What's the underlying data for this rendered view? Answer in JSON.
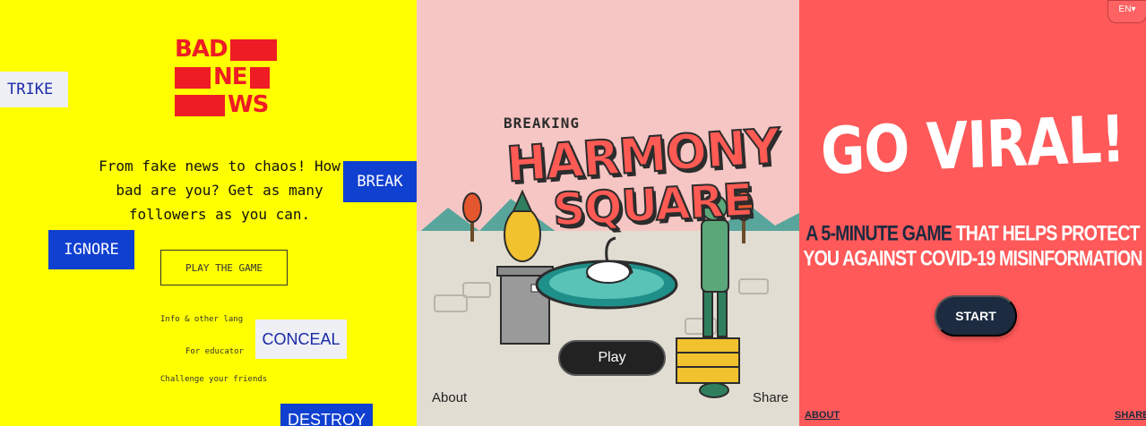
{
  "bad_news": {
    "logo": [
      "BAD",
      "NE",
      "WS"
    ],
    "tagline": [
      "From fake news to chaos! How",
      "bad are you? Get as many",
      "followers as you can."
    ],
    "play_button": "PLAY THE GAME",
    "links": [
      "Info & other lang",
      "For educator",
      "Challenge your friends"
    ],
    "tags": {
      "strike": "TRIKE",
      "break": "BREAK",
      "ignore": "IGNORE",
      "conceal": "CONCEAL",
      "destroy": "DESTROY"
    },
    "colors": {
      "background": "#ffff00",
      "logo": "#ee1c25",
      "tag": "#1040d0"
    }
  },
  "harmony_square": {
    "breaking": "BREAKING",
    "title_line1": "HARMONY",
    "title_line2": "SQUARE",
    "play_button": "Play",
    "about_link": "About",
    "share_link": "Share",
    "colors": {
      "sky": "#f6c6c4",
      "title": "#ff5a54"
    }
  },
  "go_viral": {
    "language": "EN",
    "title": "GO VIRAL!",
    "subtitle_dark": "A 5-MINUTE GAME",
    "subtitle_light_1": " THAT HELPS PROTECT",
    "subtitle_line2": "YOU AGAINST COVID-19 MISINFORMATION",
    "start_button": "START",
    "about_link": "ABOUT",
    "share_link": "SHARE",
    "colors": {
      "background": "#ff5959",
      "button": "#1c2b3f"
    }
  }
}
